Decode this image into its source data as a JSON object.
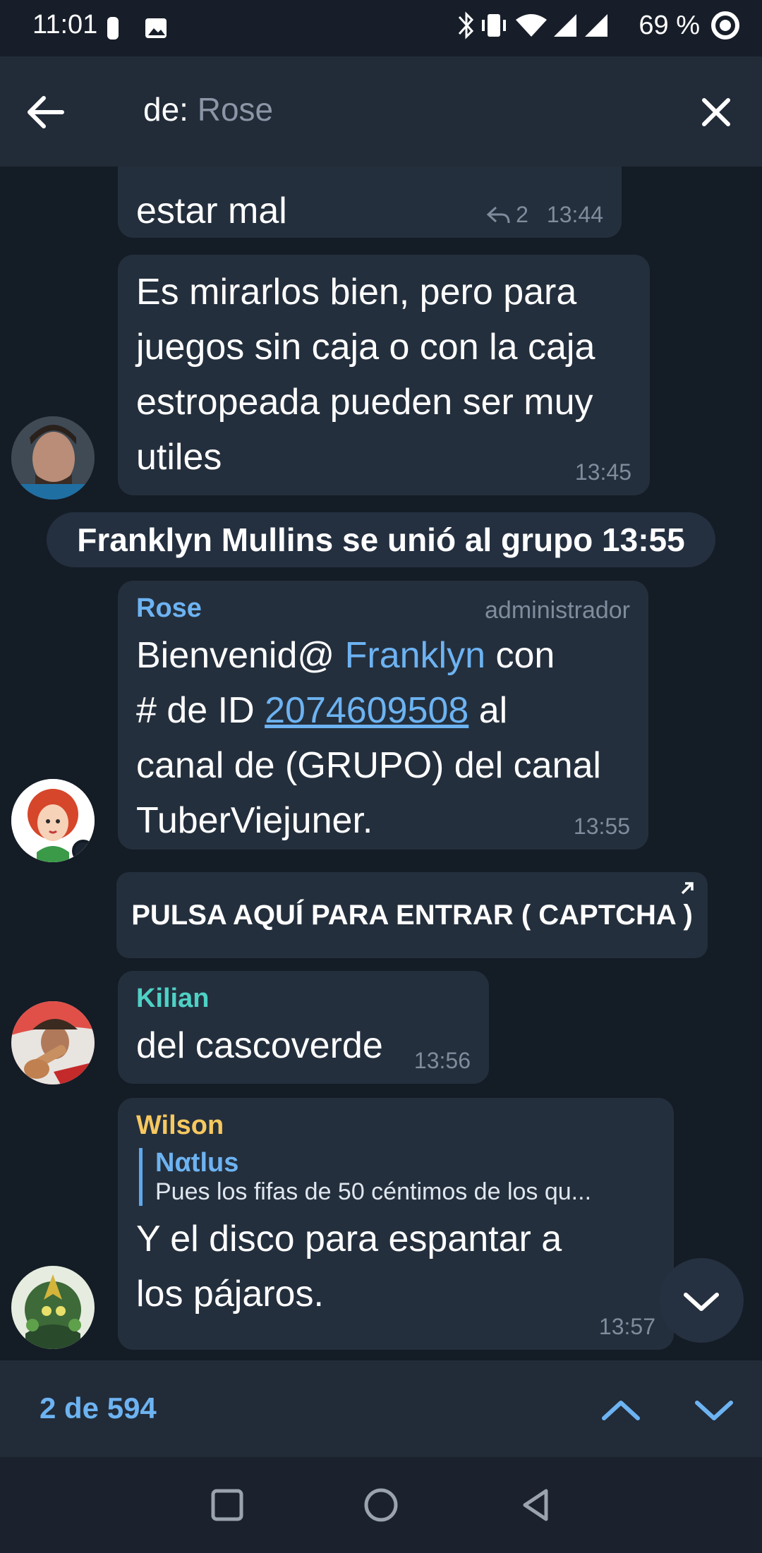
{
  "status_bar": {
    "time": "11:01",
    "battery": "69 %",
    "icons": [
      "watch-icon",
      "image-icon",
      "bluetooth-icon",
      "vibrate-icon",
      "wifi-icon",
      "signal-icon",
      "signal-icon",
      "data-saver-icon"
    ]
  },
  "header": {
    "search_prefix": "de:",
    "search_value": "Rose"
  },
  "messages": [
    {
      "text": "estar mal",
      "replies": "2",
      "time": "13:44"
    },
    {
      "text_lines": [
        "Es mirarlos bien, pero para",
        "juegos sin caja o con la caja",
        "estropeada pueden ser muy",
        "utiles"
      ],
      "time": "13:45"
    },
    {
      "service": "Franklyn Mullins se unió al grupo  13:55"
    },
    {
      "sender": "Rose",
      "role": "administrador",
      "p1": "Bienvenid@ ",
      "mention": "Franklyn",
      "p2": " con",
      "p3": "# de ID ",
      "id_link": "2074609508",
      "p4": " al",
      "line3": "canal de (GRUPO) del canal",
      "line4": "TuberViejuner.",
      "time": "13:55",
      "button": "PULSA AQUÍ PARA ENTRAR ( CAPTCHA )"
    },
    {
      "sender": "Kilian",
      "text": "del cascoverde",
      "time": "13:56"
    },
    {
      "sender": "Wilson",
      "reply_name": "Nαtlus",
      "reply_text": "Pues los fifas de 50 céntimos de los qu...",
      "text_lines": [
        "Y el disco para espantar a",
        "los pájaros."
      ],
      "time": "13:57"
    }
  ],
  "footer": {
    "counter": "2 de 594"
  },
  "colors": {
    "accent": "#6db3f2",
    "rose_name": "#6db3f2",
    "kilian_name": "#4fd1c5",
    "wilson_name": "#f6c85f",
    "bubble": "#242f3d",
    "background": "#141c26"
  }
}
